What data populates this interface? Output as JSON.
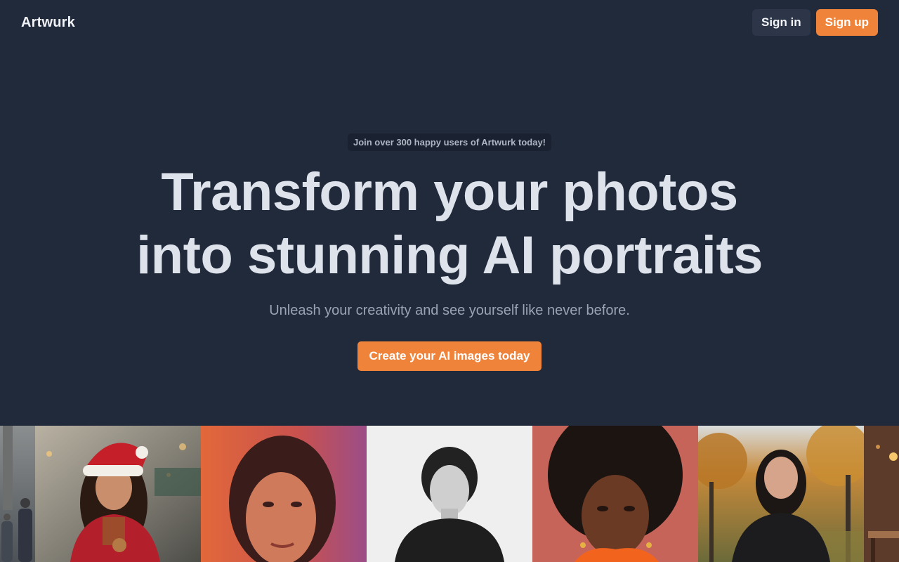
{
  "header": {
    "logo": "Artwurk",
    "signin_label": "Sign in",
    "signup_label": "Sign up"
  },
  "hero": {
    "pill": "Join over 300 happy users of Artwurk today!",
    "headline_line1": "Transform your photos",
    "headline_line2": "into stunning AI portraits",
    "subhead": "Unleash your creativity and see yourself like never before.",
    "cta_label": "Create your AI images today"
  },
  "colors": {
    "background": "#212a3b",
    "accent": "#f0833a",
    "button_dark": "#2c3648"
  },
  "gallery": {
    "images": [
      "city-street-portrait",
      "christmas-santa-hat-portrait",
      "warm-orange-light-portrait",
      "black-and-white-portrait",
      "afro-orange-jacket-portrait",
      "autumn-park-portrait",
      "cafe-interior-portrait"
    ]
  }
}
